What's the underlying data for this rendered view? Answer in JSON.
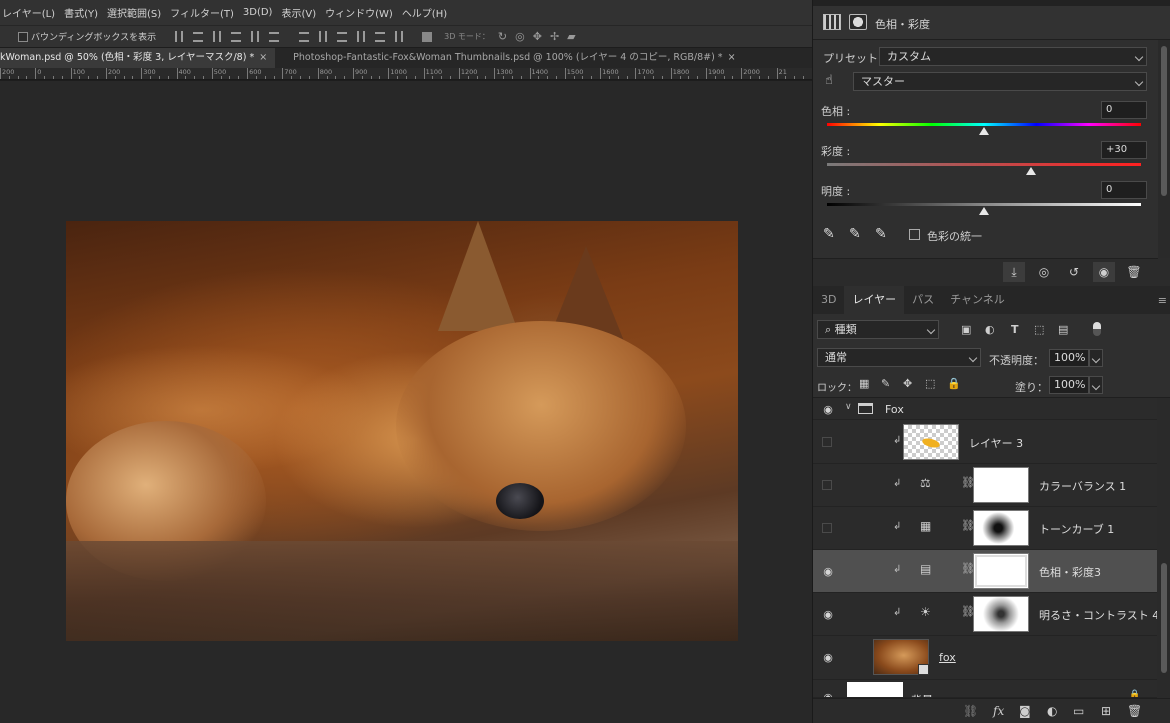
{
  "menubar": [
    "レイヤー(L)",
    "書式(Y)",
    "選択範囲(S)",
    "フィルター(T)",
    "3D(D)",
    "表示(V)",
    "ウィンドウ(W)",
    "ヘルプ(H)"
  ],
  "options": {
    "bounding_box_label": "バウンディングボックスを表示",
    "mode_3d_label": "3D モード："
  },
  "tabs": [
    {
      "label": "kWoman.psd @ 50% (色相・彩度 3, レイヤーマスク/8) *",
      "close": "×",
      "active": true
    },
    {
      "label": "Photoshop-Fantastic-Fox&Woman Thumbnails.psd @ 100% (レイヤー 4 のコピー, RGB/8#) *",
      "close": "×",
      "active": false
    }
  ],
  "ruler_labels": [
    "200",
    "0",
    "100",
    "200",
    "300",
    "400",
    "500",
    "600",
    "700",
    "800",
    "900",
    "1000",
    "1100",
    "1200",
    "1300",
    "1400",
    "1500",
    "1600",
    "1700",
    "1800",
    "1900",
    "2000",
    "21"
  ],
  "properties": {
    "title": "色相・彩度",
    "preset_label": "プリセット：",
    "preset_value": "カスタム",
    "channel_value": "マスター",
    "hue_label": "色相 :",
    "hue_value": "0",
    "hue_fraction": 0.5,
    "saturation_label": "彩度 :",
    "saturation_value": "+30",
    "saturation_fraction": 0.65,
    "lightness_label": "明度 :",
    "lightness_value": "0",
    "lightness_fraction": 0.5,
    "colorize_label": "色彩の統一",
    "colorize_checked": false
  },
  "layers_panel": {
    "tabs": [
      "3D",
      "レイヤー",
      "パス",
      "チャンネル"
    ],
    "active_tab": "レイヤー",
    "filter_kind": "種類",
    "blend_mode": "通常",
    "opacity_label": "不透明度：",
    "opacity_value": "100%",
    "lock_label": "ロック：",
    "fill_label": "塗り：",
    "fill_value": "100%",
    "group_name": "Fox",
    "layers": [
      {
        "name": "レイヤー 3",
        "visible": false,
        "type": "pixel"
      },
      {
        "name": "カラーバランス 1",
        "visible": false,
        "type": "color-balance"
      },
      {
        "name": "トーンカーブ 1",
        "visible": false,
        "type": "curves"
      },
      {
        "name": "色相・彩度3",
        "visible": true,
        "type": "hue-saturation",
        "selected": true
      },
      {
        "name": "明るさ・コントラスト 4",
        "visible": true,
        "type": "brightness-contrast"
      },
      {
        "name": "fox",
        "visible": true,
        "type": "smart-object"
      },
      {
        "name": "背景",
        "visible": true,
        "type": "background"
      }
    ]
  },
  "colors": {
    "panel_bg": "#2b2b2b",
    "selected_layer": "#505050",
    "canvas_bg": "#282828"
  }
}
